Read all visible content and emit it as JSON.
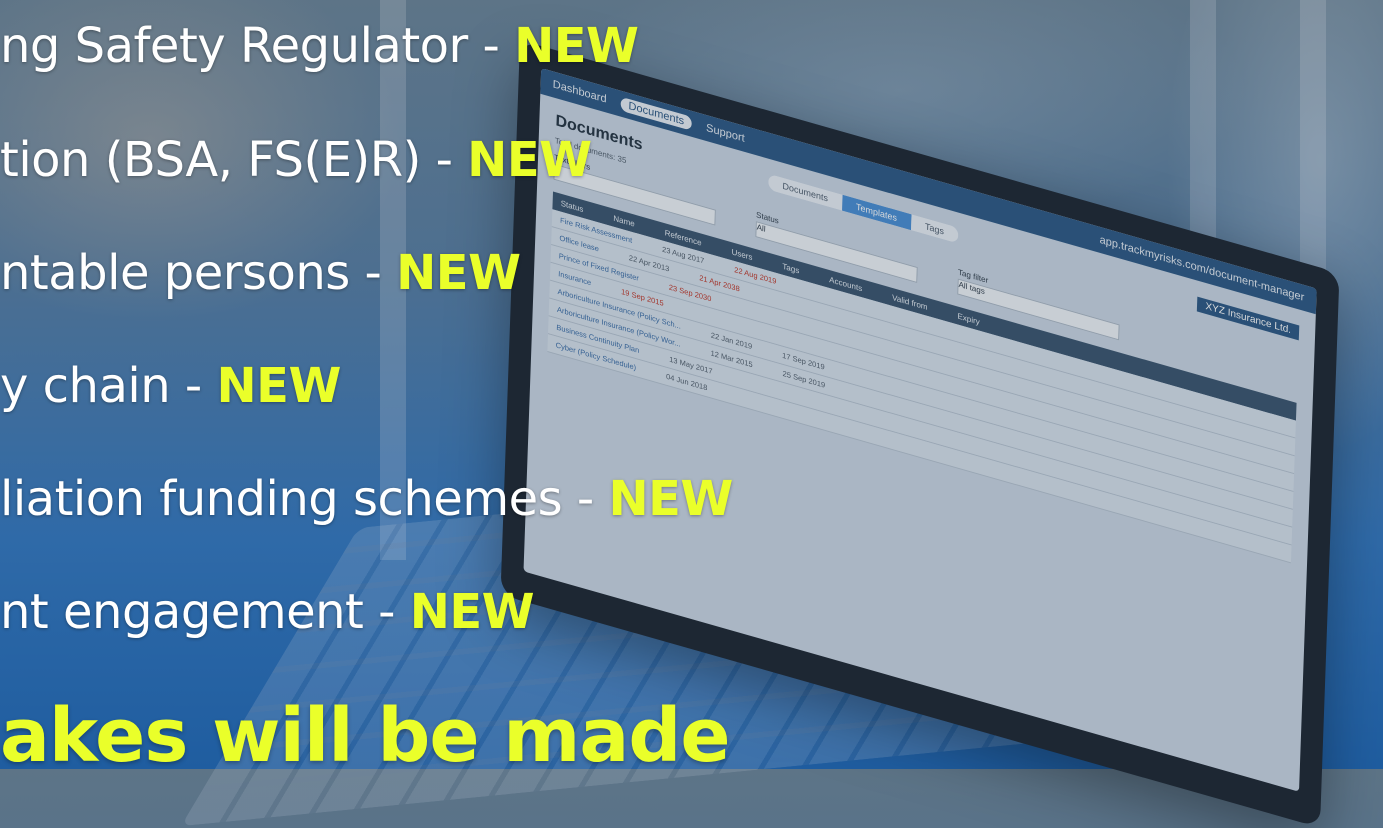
{
  "slide": {
    "lines": [
      {
        "text": "ng Safety Regulator - ",
        "tag": "NEW"
      },
      {
        "text": "tion (BSA, FS(E)R)  - ",
        "tag": "NEW"
      },
      {
        "text": "ntable persons - ",
        "tag": "NEW"
      },
      {
        "text": "y chain  - ",
        "tag": "NEW"
      },
      {
        "text": "liation funding schemes  - ",
        "tag": "NEW"
      },
      {
        "text": "nt engagement  - ",
        "tag": "NEW"
      }
    ],
    "headline": "akes will be made"
  },
  "laptop_app": {
    "nav": [
      "Dashboard",
      "Documents",
      "Support"
    ],
    "url": "app.trackmyrisks.com/document-manager",
    "title": "Documents",
    "tabs": [
      "Documents",
      "Templates",
      "Tags"
    ],
    "company": "XYZ Insurance Ltd.",
    "total": "Total documents: 35",
    "text_filters": "Text filters",
    "status": "Status",
    "status_value": "All",
    "tag_filter": "Tag filter",
    "tag_value": "All tags",
    "columns": [
      "Status",
      "Name",
      "Reference",
      "Users",
      "Tags",
      "Accounts",
      "Valid from",
      "Expiry"
    ],
    "rows": [
      {
        "name": "Fire Risk Assessment",
        "from": "23 Aug 2017",
        "expiry": "22 Aug 2019"
      },
      {
        "name": "Office lease",
        "from": "22 Apr 2013",
        "expiry": "21 Apr 2038"
      },
      {
        "name": "Prince of Fixed Register",
        "from": "23 Sep 2030",
        "expiry": ""
      },
      {
        "name": "Insurance",
        "from": "19 Sep 2015",
        "expiry": ""
      },
      {
        "name": "Arboriculture Insurance (Policy Sch...",
        "from": "22 Jan 2019",
        "expiry": "17 Sep 2019"
      },
      {
        "name": "Arboriculture Insurance (Policy Wor...",
        "from": "12 Mar 2015",
        "expiry": "25 Sep 2019"
      },
      {
        "name": "Business Continuity Plan",
        "from": "13 May 2017",
        "expiry": ""
      },
      {
        "name": "Cyber (Policy Schedule)",
        "from": "04 Jun 2018",
        "expiry": ""
      }
    ]
  }
}
